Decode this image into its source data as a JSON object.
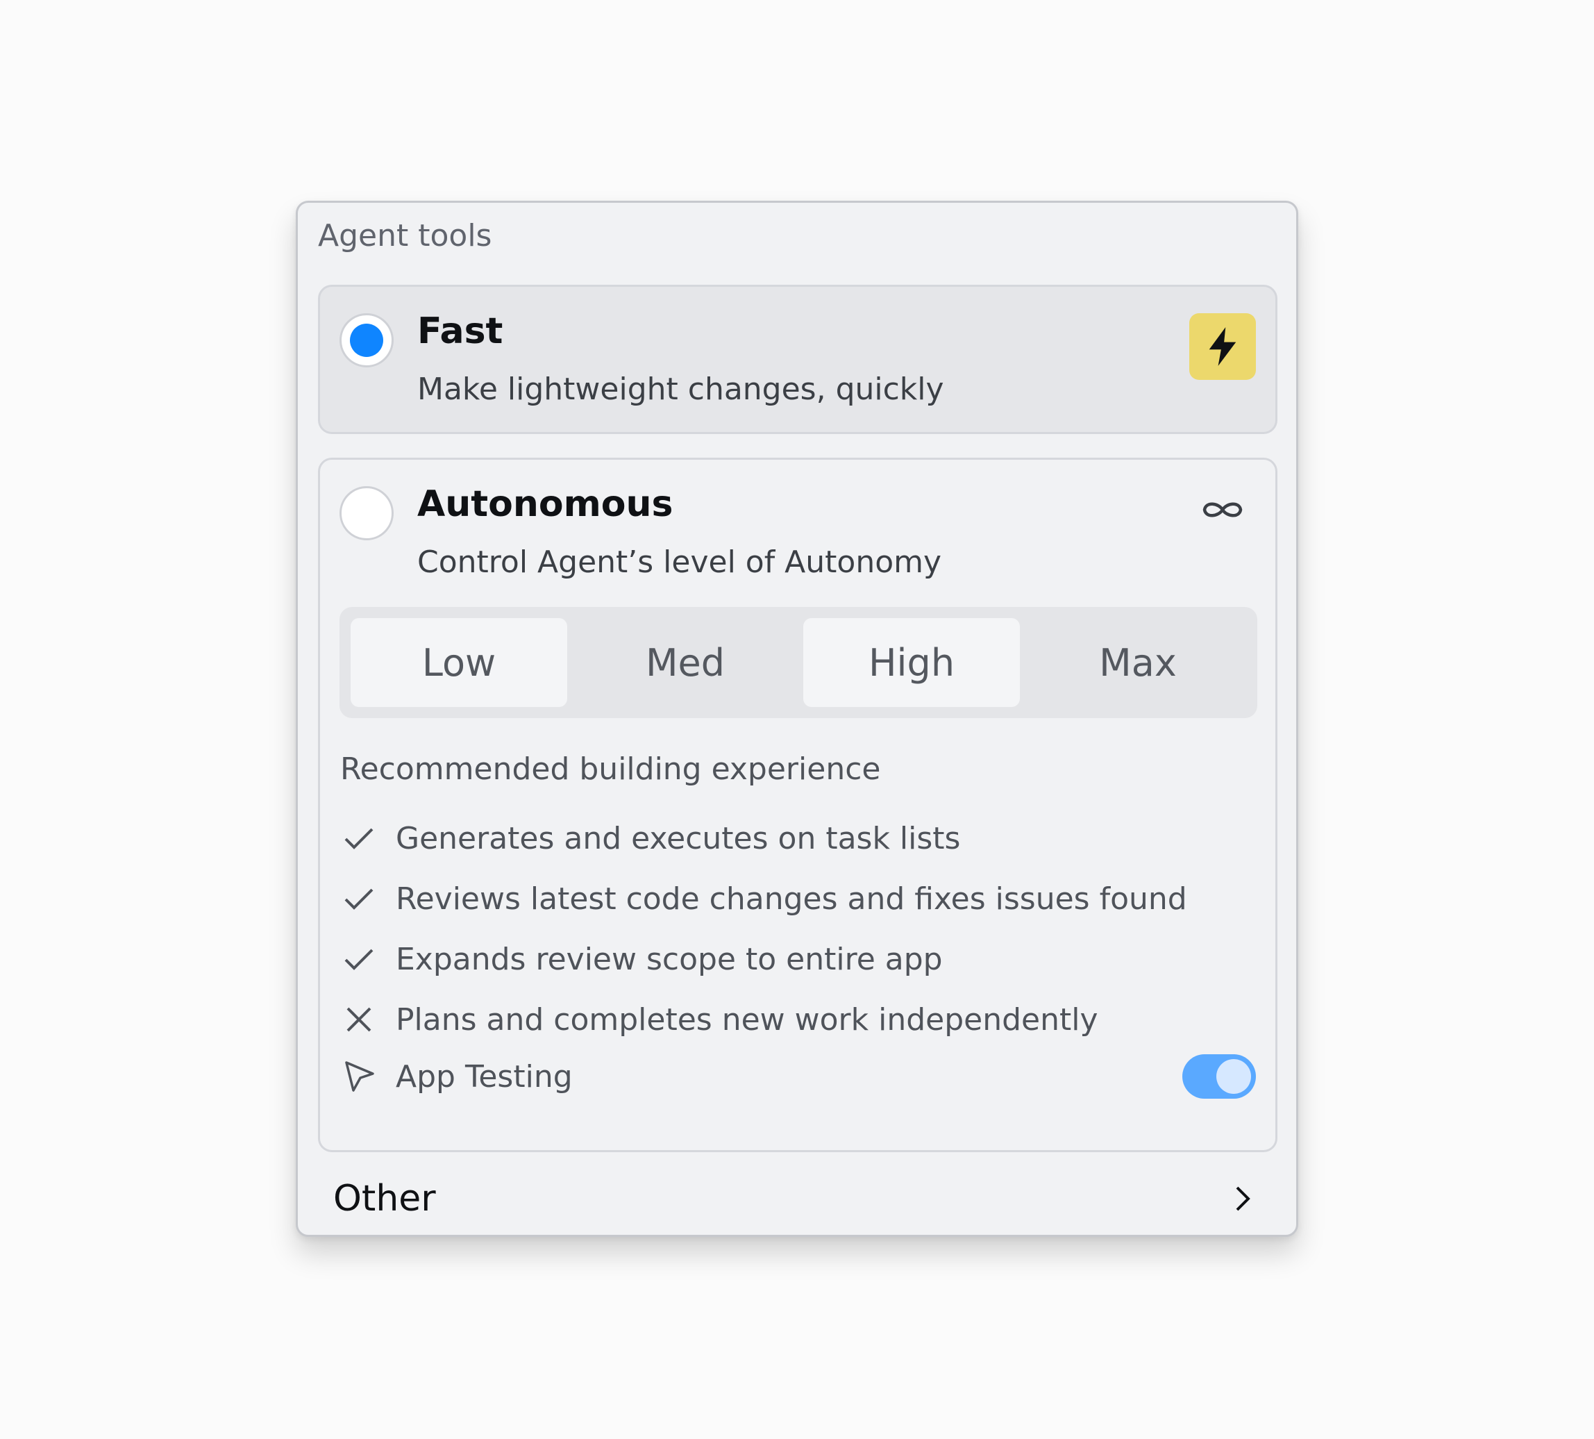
{
  "panel": {
    "title": "Agent tools"
  },
  "options": {
    "fast": {
      "title": "Fast",
      "description": "Make lightweight changes, quickly",
      "selected": true,
      "icon": "bolt-icon",
      "badge_color": "#ecd86c"
    },
    "autonomous": {
      "title": "Autonomous",
      "description": "Control Agent’s level of Autonomy",
      "selected": false,
      "icon": "infinity-icon"
    }
  },
  "autonomy_levels": {
    "low": "Low",
    "med": "Med",
    "high": "High",
    "max": "Max"
  },
  "recommended": {
    "title": "Recommended building experience",
    "features": [
      {
        "text": "Generates and executes on task lists",
        "icon": "check-icon"
      },
      {
        "text": "Reviews latest code changes and fixes issues found",
        "icon": "check-icon"
      },
      {
        "text": "Expands review scope to entire app",
        "icon": "check-icon"
      },
      {
        "text": "Plans and completes new work independently",
        "icon": "x-icon"
      }
    ]
  },
  "app_testing": {
    "label": "App Testing",
    "icon": "cursor-pointer-icon",
    "enabled": true
  },
  "other": {
    "label": "Other",
    "icon": "chevron-right-icon"
  },
  "colors": {
    "accent": "#0f85ff",
    "toggle_on": "#5aa9ff"
  }
}
